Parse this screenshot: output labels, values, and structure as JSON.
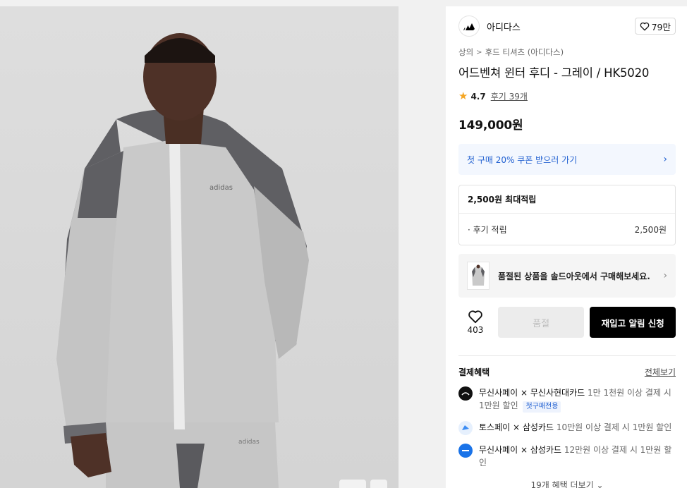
{
  "brand": {
    "name": "아디다스",
    "like_count": "79만"
  },
  "breadcrumb": [
    "상의",
    "후드 티셔츠 (아디다스)"
  ],
  "product": {
    "title": "어드벤쳐 윈터 후디 - 그레이 / HK5020",
    "rating": "4.7",
    "review_text": "후기 39개",
    "price": "149,000원"
  },
  "coupon": {
    "text": "첫 구매 20% 쿠폰 받으러 가기"
  },
  "points": {
    "max_label": "2,500원 최대적립",
    "review_label": "· 후기 적립",
    "review_value": "2,500원"
  },
  "soldout_banner": {
    "text": "품절된 상품을 솔드아웃에서 구매해보세요."
  },
  "actions": {
    "like_count": "403",
    "soldout_label": "품절",
    "restock_label": "재입고 알림 신청"
  },
  "benefits": {
    "heading": "결제혜택",
    "see_all": "전체보기",
    "items": [
      {
        "brand": "무신사페이 × 무신사현대카드",
        "desc": " 1만 1천원 이상 결제 시 1만원 할인",
        "badge": "첫구매전용",
        "icon_color": "#111111"
      },
      {
        "brand": "토스페이 × 삼성카드",
        "desc": " 10만원 이상 결제 시 1만원 할인",
        "icon_color": "#3b8cf3"
      },
      {
        "brand": "무신사페이 × 삼성카드",
        "desc": " 12만원 이상 결제 시 1만원 할인",
        "icon_color": "#1a73e8"
      }
    ],
    "more": "19개 혜택 더보기"
  }
}
